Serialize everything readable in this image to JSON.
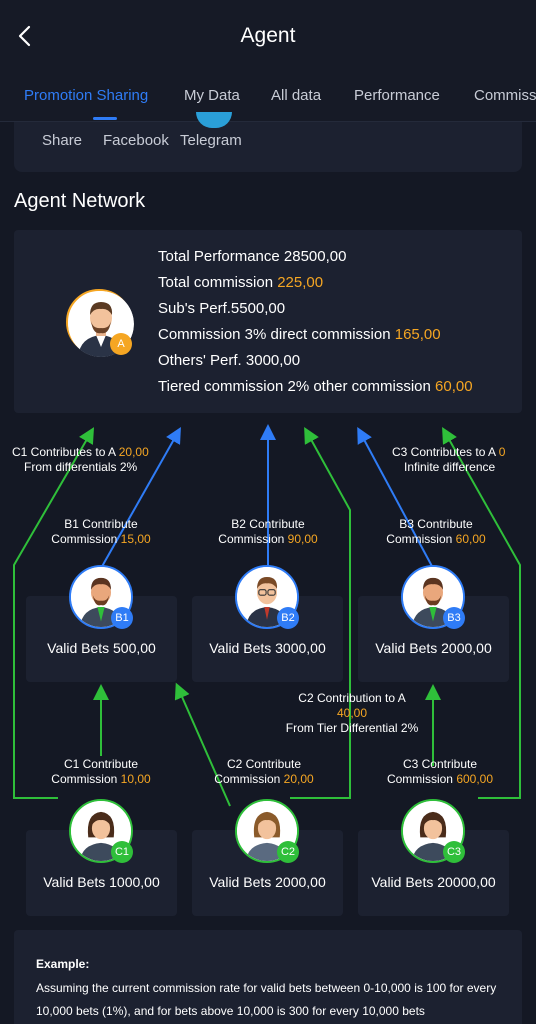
{
  "header": {
    "title": "Agent"
  },
  "tabs": [
    {
      "label": "Promotion Sharing",
      "active": true
    },
    {
      "label": "My Data"
    },
    {
      "label": "All data"
    },
    {
      "label": "Performance"
    },
    {
      "label": "Commiss"
    }
  ],
  "share": {
    "items": [
      "Share",
      "Facebook",
      "Telegram"
    ]
  },
  "network": {
    "title": "Agent Network",
    "stats": {
      "total_performance": "Total Performance 28500,00",
      "total_commission_label": "Total commission ",
      "total_commission_value": "225,00",
      "subs_perf": "Sub's Perf.5500,00",
      "direct_label": "Commission 3% direct commission ",
      "direct_value": "165,00",
      "others_perf": "Others' Perf. 3000,00",
      "tiered_label": "Tiered commission 2% other commission ",
      "tiered_value": "60,00"
    },
    "badges": {
      "a": "A",
      "b1": "B1",
      "b2": "B2",
      "b3": "B3",
      "c1": "C1",
      "c2": "C2",
      "c3": "C3"
    },
    "notes": {
      "c1_to_a_line1": "C1 Contributes to A ",
      "c1_to_a_value": "20,00",
      "c1_to_a_line2": "From differentials 2%",
      "c3_to_a_line1": "C3 Contributes to A ",
      "c3_to_a_value": "0",
      "c3_to_a_line2": "Infinite difference",
      "c2_to_a_line1": "C2 Contribution to A",
      "c2_to_a_value": "40,00",
      "c2_to_a_line3": "From Tier Differential 2%"
    },
    "b_level": [
      {
        "contribute": "B1 Contribute",
        "commission_label": "Commission ",
        "commission_value": "15,00",
        "valid_bets": "Valid Bets 500,00"
      },
      {
        "contribute": "B2 Contribute",
        "commission_label": "Commission ",
        "commission_value": "90,00",
        "valid_bets": "Valid Bets 3000,00"
      },
      {
        "contribute": "B3 Contribute",
        "commission_label": "Commission ",
        "commission_value": "60,00",
        "valid_bets": "Valid Bets 2000,00"
      }
    ],
    "c_level": [
      {
        "contribute": "C1 Contribute",
        "commission_label": "Commission ",
        "commission_value": "10,00",
        "valid_bets": "Valid Bets 1000,00"
      },
      {
        "contribute": "C2 Contribute",
        "commission_label": "Commission ",
        "commission_value": "20,00",
        "valid_bets": "Valid Bets 2000,00"
      },
      {
        "contribute": "C3 Contribute",
        "commission_label": "Commission ",
        "commission_value": "600,00",
        "valid_bets": "Valid Bets 20000,00"
      }
    ]
  },
  "example": {
    "heading": "Example:",
    "text": "Assuming the current commission rate for valid bets between 0-10,000 is 100 for every 10,000 bets (1%), and for bets above 10,000 is 300 for every 10,000 bets"
  },
  "colors": {
    "accent": "#2f7cf6",
    "highlight": "#f5a623",
    "green": "#2fbf3a",
    "background": "#141824",
    "card": "#1c2130"
  }
}
